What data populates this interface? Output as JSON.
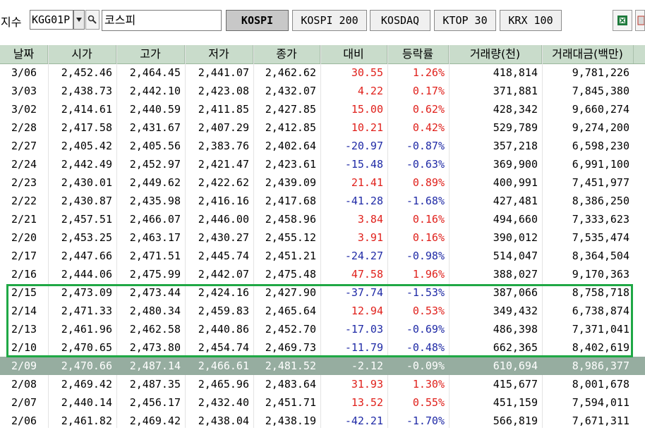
{
  "toolbar": {
    "index_label": "지수",
    "code_value": "KGG01P",
    "name_value": "코스피",
    "buttons": [
      "KOSPI",
      "KOSPI 200",
      "KOSDAQ",
      "KTOP 30",
      "KRX 100"
    ],
    "active_button": "KOSPI",
    "icons": [
      "dropdown-arrow-icon",
      "search-icon",
      "excel-icon",
      "export-icon"
    ]
  },
  "table": {
    "headers": [
      "날짜",
      "시가",
      "고가",
      "저가",
      "종가",
      "대비",
      "등락률",
      "거래량(천)",
      "거래대금(백만)"
    ],
    "colors": {
      "up": "#e0201b",
      "down": "#1f2aa6",
      "header_bg": "#c9dccb",
      "selected_bg": "#96ada0",
      "highlight_border": "#1fa845"
    },
    "selected_row_index": 16,
    "highlighted_rows": [
      12,
      13,
      14,
      15
    ],
    "rows": [
      {
        "date": "3/06",
        "open": "2,452.46",
        "high": "2,464.45",
        "low": "2,441.07",
        "close": "2,462.62",
        "change": "30.55",
        "rate": "1.26%",
        "volume": "418,814",
        "amount": "9,781,226",
        "dir": "up"
      },
      {
        "date": "3/03",
        "open": "2,438.73",
        "high": "2,442.10",
        "low": "2,423.08",
        "close": "2,432.07",
        "change": "4.22",
        "rate": "0.17%",
        "volume": "371,881",
        "amount": "7,845,380",
        "dir": "up"
      },
      {
        "date": "3/02",
        "open": "2,414.61",
        "high": "2,440.59",
        "low": "2,411.85",
        "close": "2,427.85",
        "change": "15.00",
        "rate": "0.62%",
        "volume": "428,342",
        "amount": "9,660,274",
        "dir": "up"
      },
      {
        "date": "2/28",
        "open": "2,417.58",
        "high": "2,431.67",
        "low": "2,407.29",
        "close": "2,412.85",
        "change": "10.21",
        "rate": "0.42%",
        "volume": "529,789",
        "amount": "9,274,200",
        "dir": "up"
      },
      {
        "date": "2/27",
        "open": "2,405.42",
        "high": "2,405.56",
        "low": "2,383.76",
        "close": "2,402.64",
        "change": "-20.97",
        "rate": "-0.87%",
        "volume": "357,218",
        "amount": "6,598,230",
        "dir": "down"
      },
      {
        "date": "2/24",
        "open": "2,442.49",
        "high": "2,452.97",
        "low": "2,421.47",
        "close": "2,423.61",
        "change": "-15.48",
        "rate": "-0.63%",
        "volume": "369,900",
        "amount": "6,991,100",
        "dir": "down"
      },
      {
        "date": "2/23",
        "open": "2,430.01",
        "high": "2,449.62",
        "low": "2,422.62",
        "close": "2,439.09",
        "change": "21.41",
        "rate": "0.89%",
        "volume": "400,991",
        "amount": "7,451,977",
        "dir": "up"
      },
      {
        "date": "2/22",
        "open": "2,430.87",
        "high": "2,435.98",
        "low": "2,416.16",
        "close": "2,417.68",
        "change": "-41.28",
        "rate": "-1.68%",
        "volume": "427,481",
        "amount": "8,386,250",
        "dir": "down"
      },
      {
        "date": "2/21",
        "open": "2,457.51",
        "high": "2,466.07",
        "low": "2,446.00",
        "close": "2,458.96",
        "change": "3.84",
        "rate": "0.16%",
        "volume": "494,660",
        "amount": "7,333,623",
        "dir": "up"
      },
      {
        "date": "2/20",
        "open": "2,453.25",
        "high": "2,463.17",
        "low": "2,430.27",
        "close": "2,455.12",
        "change": "3.91",
        "rate": "0.16%",
        "volume": "390,012",
        "amount": "7,535,474",
        "dir": "up"
      },
      {
        "date": "2/17",
        "open": "2,447.66",
        "high": "2,471.51",
        "low": "2,445.74",
        "close": "2,451.21",
        "change": "-24.27",
        "rate": "-0.98%",
        "volume": "514,047",
        "amount": "8,364,504",
        "dir": "down"
      },
      {
        "date": "2/16",
        "open": "2,444.06",
        "high": "2,475.99",
        "low": "2,442.07",
        "close": "2,475.48",
        "change": "47.58",
        "rate": "1.96%",
        "volume": "388,027",
        "amount": "9,170,363",
        "dir": "up"
      },
      {
        "date": "2/15",
        "open": "2,473.09",
        "high": "2,473.44",
        "low": "2,424.16",
        "close": "2,427.90",
        "change": "-37.74",
        "rate": "-1.53%",
        "volume": "387,066",
        "amount": "8,758,718",
        "dir": "down"
      },
      {
        "date": "2/14",
        "open": "2,471.33",
        "high": "2,480.34",
        "low": "2,459.83",
        "close": "2,465.64",
        "change": "12.94",
        "rate": "0.53%",
        "volume": "349,432",
        "amount": "6,738,874",
        "dir": "up"
      },
      {
        "date": "2/13",
        "open": "2,461.96",
        "high": "2,462.58",
        "low": "2,440.86",
        "close": "2,452.70",
        "change": "-17.03",
        "rate": "-0.69%",
        "volume": "486,398",
        "amount": "7,371,041",
        "dir": "down"
      },
      {
        "date": "2/10",
        "open": "2,470.65",
        "high": "2,473.80",
        "low": "2,454.74",
        "close": "2,469.73",
        "change": "-11.79",
        "rate": "-0.48%",
        "volume": "662,365",
        "amount": "8,402,619",
        "dir": "down"
      },
      {
        "date": "2/09",
        "open": "2,470.66",
        "high": "2,487.14",
        "low": "2,466.61",
        "close": "2,481.52",
        "change": "-2.12",
        "rate": "-0.09%",
        "volume": "610,694",
        "amount": "8,986,377",
        "dir": "down"
      },
      {
        "date": "2/08",
        "open": "2,469.42",
        "high": "2,487.35",
        "low": "2,465.96",
        "close": "2,483.64",
        "change": "31.93",
        "rate": "1.30%",
        "volume": "415,677",
        "amount": "8,001,678",
        "dir": "up"
      },
      {
        "date": "2/07",
        "open": "2,440.14",
        "high": "2,456.17",
        "low": "2,432.40",
        "close": "2,451.71",
        "change": "13.52",
        "rate": "0.55%",
        "volume": "451,159",
        "amount": "7,594,011",
        "dir": "up"
      },
      {
        "date": "2/06",
        "open": "2,461.82",
        "high": "2,469.42",
        "low": "2,438.04",
        "close": "2,438.19",
        "change": "-42.21",
        "rate": "-1.70%",
        "volume": "566,819",
        "amount": "7,671,311",
        "dir": "down"
      }
    ]
  }
}
